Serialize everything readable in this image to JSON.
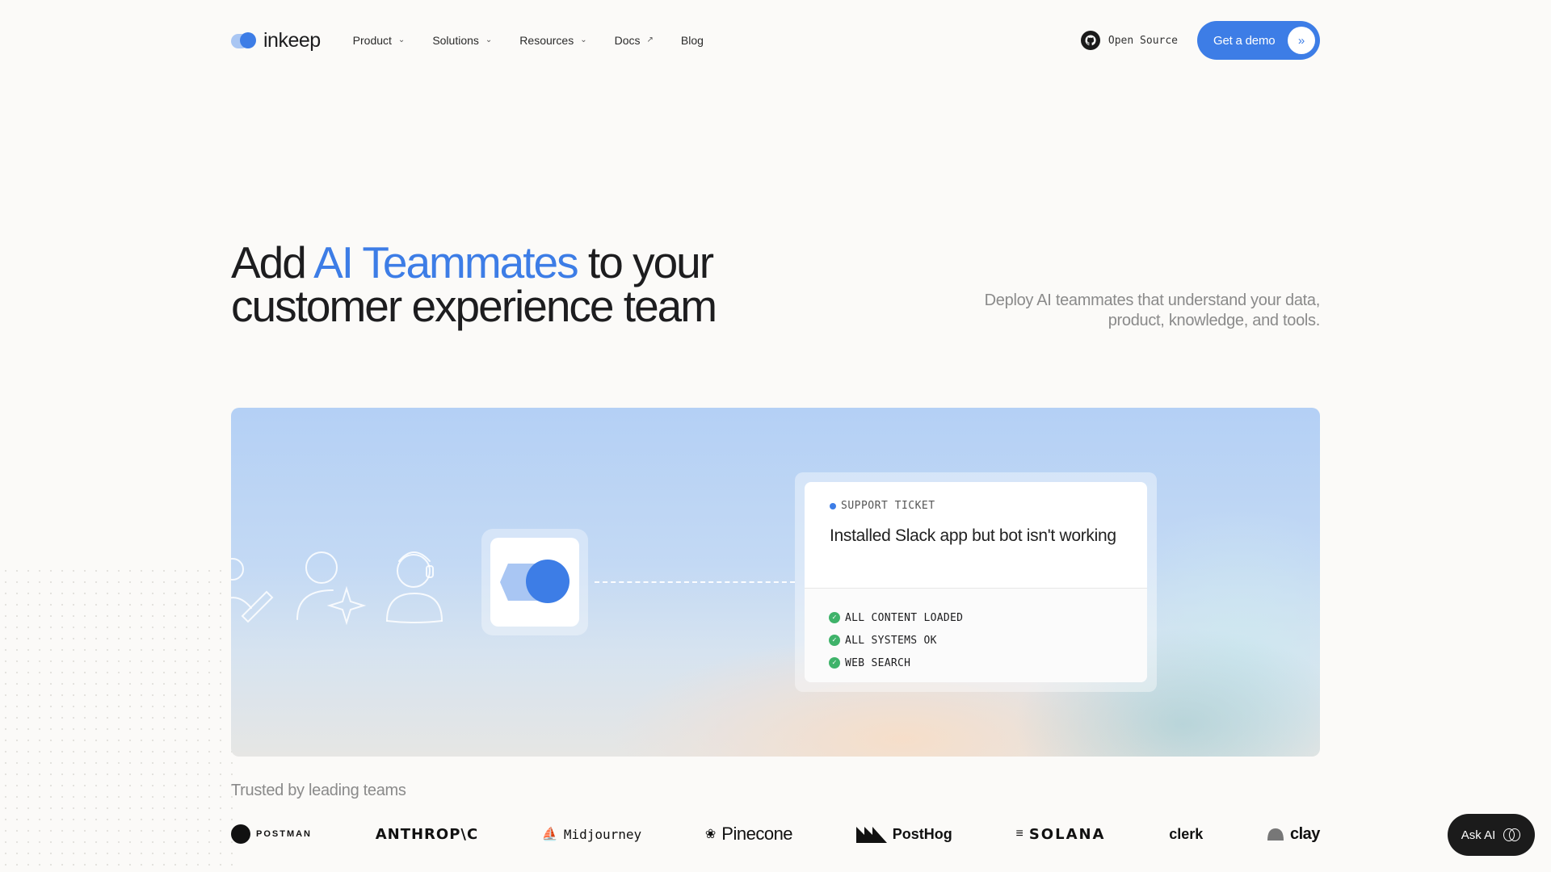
{
  "nav": {
    "logo_text": "inkeep",
    "links": [
      {
        "label": "Product",
        "icon": "chevron-down-icon"
      },
      {
        "label": "Solutions",
        "icon": "chevron-down-icon"
      },
      {
        "label": "Resources",
        "icon": "chevron-down-icon"
      },
      {
        "label": "Docs",
        "icon": "arrow-up-right-icon"
      },
      {
        "label": "Blog"
      }
    ],
    "open_source_label": "Open Source",
    "demo_label": "Get a demo",
    "accent_color": "#3d7de6"
  },
  "hero": {
    "title_pre": "Add ",
    "title_accent": "AI Teammates",
    "title_post": " to your customer experience team",
    "subtitle": "Deploy AI teammates that understand your data, product, knowledge, and tools."
  },
  "ticket": {
    "tag": "SUPPORT TICKET",
    "title": "Installed Slack app but bot isn't working",
    "checks": [
      "ALL CONTENT LOADED",
      "ALL SYSTEMS OK",
      "WEB SEARCH"
    ]
  },
  "trusted": {
    "heading": "Trusted by leading teams",
    "logos": [
      "POSTMAN",
      "ANTHROP\\C",
      "Midjourney",
      "Pinecone",
      "PostHog",
      "SOLANA",
      "clerk",
      "clay"
    ]
  },
  "ask_ai": {
    "label": "Ask AI"
  }
}
